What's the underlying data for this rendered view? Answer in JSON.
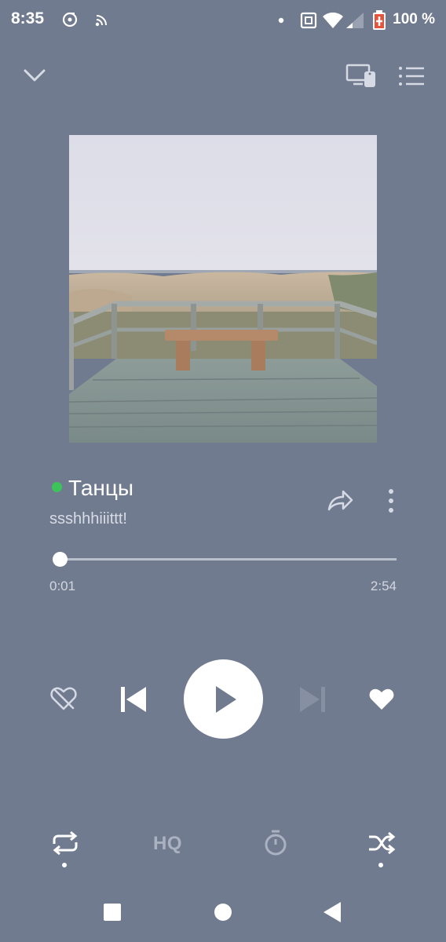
{
  "status_bar": {
    "time": "8:35",
    "battery": "100 %",
    "icons": [
      "music-app-icon",
      "cast-signal-icon",
      "notification-dot-icon",
      "nfc-icon",
      "wifi-icon",
      "signal-icon",
      "battery-icon"
    ]
  },
  "header": {
    "icons": [
      "chevron-down-icon",
      "devices-icon",
      "queue-icon"
    ]
  },
  "track": {
    "title": "Танцы",
    "artist": "ssshhhiiittt!"
  },
  "progress": {
    "elapsed": "0:01",
    "total": "2:54",
    "fraction": 0.006
  },
  "controls": {
    "icons": [
      "dislike-icon",
      "previous-icon",
      "play-icon",
      "next-icon",
      "like-icon"
    ]
  },
  "modes": {
    "hq_label": "HQ",
    "icons": [
      "repeat-icon",
      "hq-icon",
      "timer-icon",
      "shuffle-icon"
    ]
  },
  "nav_bar": {
    "icons": [
      "recents-icon",
      "home-icon",
      "back-icon"
    ]
  },
  "colors": {
    "background": "#717b8f",
    "explicit_dot": "#3cc45a"
  }
}
